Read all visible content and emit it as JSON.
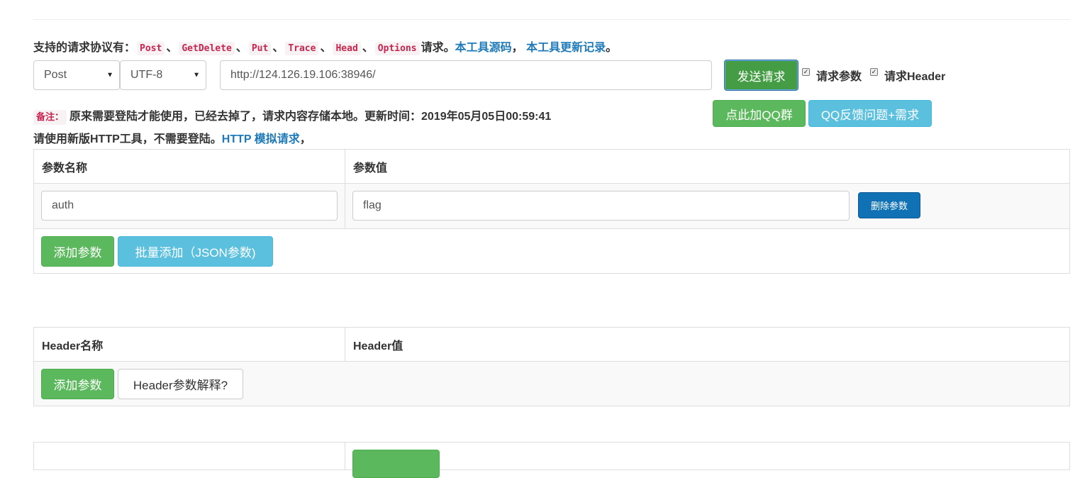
{
  "protocols": {
    "prefix": "支持的请求协议有：",
    "items": [
      "Post",
      "GetDelete",
      "Put",
      "Trace",
      "Head",
      "Options"
    ],
    "sep": "、",
    "suffix": "请求。",
    "link_source": "本工具源码",
    "comma": "，",
    "link_changelog": "本工具更新记录",
    "end": "。"
  },
  "request": {
    "method": "Post",
    "encoding": "UTF-8",
    "url": "http://124.126.19.106:38946/",
    "send_label": "发送请求",
    "check_params_label": "请求参数",
    "check_header_label": "请求Header",
    "check_params": true,
    "check_header": true
  },
  "notice": {
    "tag": "备注：",
    "text": "原来需要登陆才能使用，已经去掉了，请求内容存储本地。更新时间：2019年05月05日00:59:41",
    "line2_prefix": "请使用新版HTTP工具，不需要登陆。",
    "line2_link": "HTTP 模拟请求",
    "line2_suffix": "，",
    "qq_group_label": "点此加QQ群",
    "qq_feedback_label": "QQ反馈问题+需求"
  },
  "params_table": {
    "col_name": "参数名称",
    "col_value": "参数值",
    "rows": [
      {
        "name": "auth",
        "value": "flag"
      }
    ],
    "delete_label": "删除参数",
    "add_label": "添加参数",
    "bulk_add_label": "批量添加（JSON参数)"
  },
  "header_table": {
    "col_name": "Header名称",
    "col_value": "Header值",
    "add_label": "添加参数",
    "explain_label": "Header参数解释?"
  },
  "colors": {
    "green": "#5cb85c",
    "info": "#5bc0de",
    "primary": "#1072b5",
    "link": "#1e7ab8",
    "code": "#c7254e"
  }
}
